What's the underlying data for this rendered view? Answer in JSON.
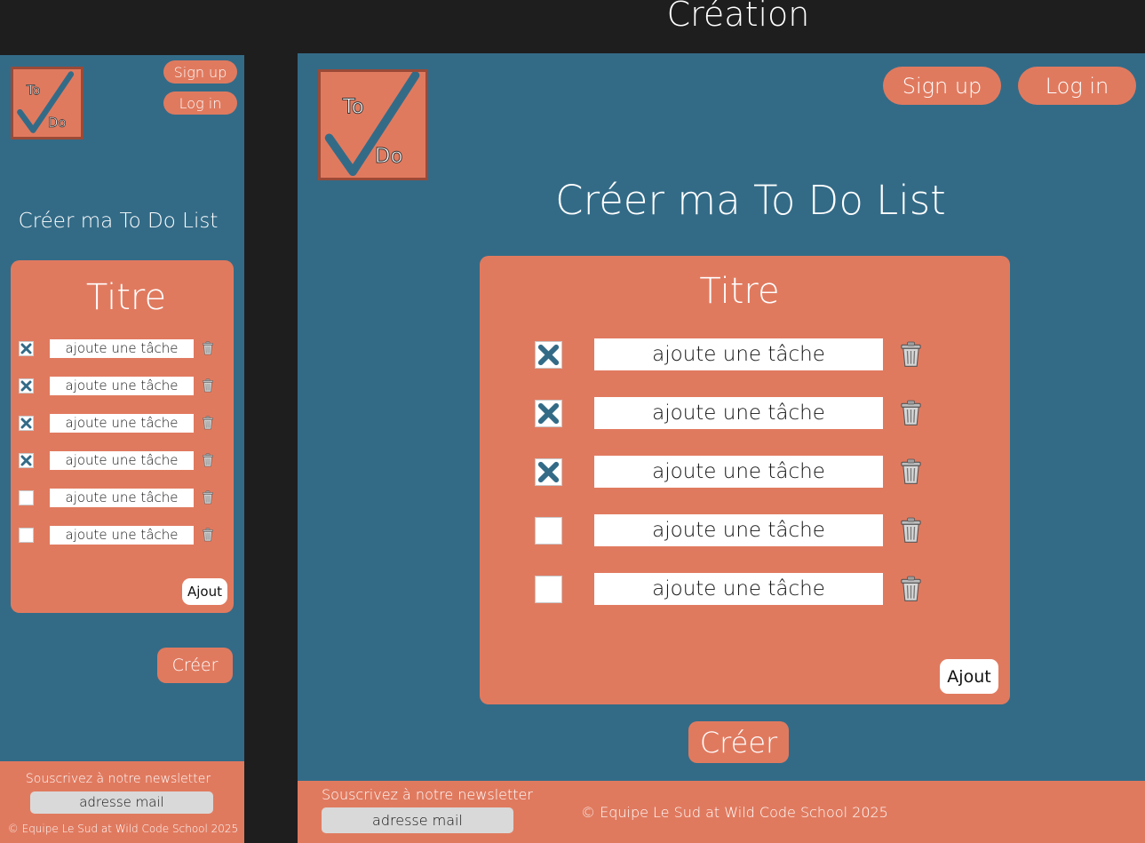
{
  "page": {
    "title": "Création"
  },
  "nav": {
    "signup": "Sign up",
    "login": "Log in"
  },
  "logo": {
    "text_top": "To",
    "text_bottom": "Do"
  },
  "main": {
    "heading": "Créer ma To Do List",
    "card_title": "Titre",
    "task_placeholder": "ajoute une tâche",
    "add_button": "Ajout",
    "create_button": "Créer"
  },
  "mobile_tasks": [
    {
      "checked": true
    },
    {
      "checked": true
    },
    {
      "checked": true
    },
    {
      "checked": true
    },
    {
      "checked": false
    },
    {
      "checked": false
    }
  ],
  "desktop_tasks": [
    {
      "checked": true
    },
    {
      "checked": true
    },
    {
      "checked": true
    },
    {
      "checked": false
    },
    {
      "checked": false
    }
  ],
  "footer": {
    "newsletter": "Souscrivez à notre newsletter",
    "email_placeholder": "adresse mail",
    "copyright": "© Equipe Le Sud at Wild Code School 2025"
  },
  "colors": {
    "primary": "#336b87",
    "accent": "#e07a5f",
    "dark": "#1e1e1e"
  },
  "icons": [
    "checkmark-logo-icon",
    "cross-check-icon",
    "trash-icon"
  ]
}
